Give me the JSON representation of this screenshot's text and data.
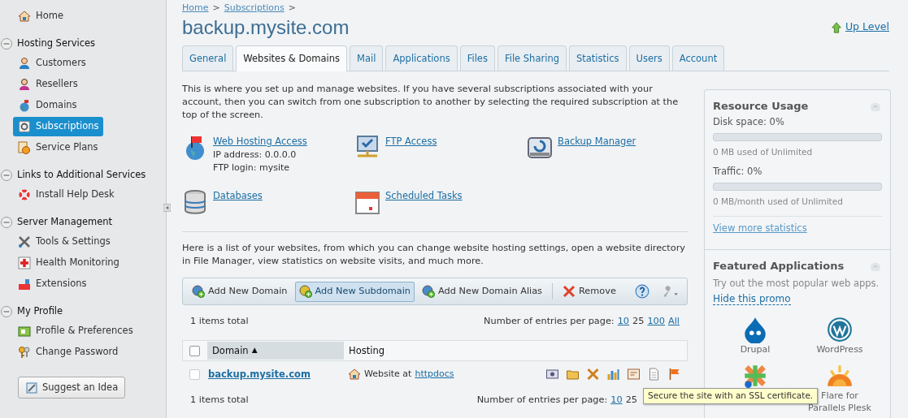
{
  "sidebar": {
    "home": {
      "label": "Home"
    },
    "sections": [
      {
        "title": "Hosting Services",
        "expanded": true,
        "items": [
          {
            "label": "Customers",
            "selected": false
          },
          {
            "label": "Resellers",
            "selected": false
          },
          {
            "label": "Domains",
            "selected": false
          },
          {
            "label": "Subscriptions",
            "selected": true
          },
          {
            "label": "Service Plans",
            "selected": false
          }
        ]
      },
      {
        "title": "Links to Additional Services",
        "expanded": true,
        "items": [
          {
            "label": "Install Help Desk",
            "selected": false
          }
        ]
      },
      {
        "title": "Server Management",
        "expanded": true,
        "items": [
          {
            "label": "Tools & Settings",
            "selected": false
          },
          {
            "label": "Health Monitoring",
            "selected": false
          },
          {
            "label": "Extensions",
            "selected": false
          }
        ]
      },
      {
        "title": "My Profile",
        "expanded": true,
        "items": [
          {
            "label": "Profile & Preferences",
            "selected": false
          },
          {
            "label": "Change Password",
            "selected": false
          }
        ]
      }
    ],
    "suggest_button": "Suggest an Idea"
  },
  "breadcrumbs": [
    "Home",
    "Subscriptions"
  ],
  "breadcrumb_separator": ">",
  "title": "backup.mysite.com",
  "up_level": "Up Level",
  "tabs": [
    {
      "label": "General",
      "selected": false
    },
    {
      "label": "Websites & Domains",
      "selected": true
    },
    {
      "label": "Mail",
      "selected": false
    },
    {
      "label": "Applications",
      "selected": false
    },
    {
      "label": "Files",
      "selected": false
    },
    {
      "label": "File Sharing",
      "selected": false
    },
    {
      "label": "Statistics",
      "selected": false
    },
    {
      "label": "Users",
      "selected": false
    },
    {
      "label": "Account",
      "selected": false
    }
  ],
  "intro": "This is where you set up and manage websites. If you have several subscriptions associated with your account, then you can switch from one subscription to another by selecting the required subscription at the top of the screen.",
  "tools": [
    {
      "label": "Web Hosting Access",
      "details": [
        "IP address: 0.0.0.0",
        "FTP login: mysite"
      ]
    },
    {
      "label": "FTP Access"
    },
    {
      "label": "Backup Manager"
    },
    {
      "label": "Databases"
    },
    {
      "label": "Scheduled Tasks"
    }
  ],
  "list_intro": "Here is a list of your websites, from which you can change website hosting settings, open a website directory in File Manager, view statistics on website visits, and much more.",
  "toolbar": [
    {
      "label": "Add New Domain",
      "kind": "add",
      "selected": false
    },
    {
      "label": "Add New Subdomain",
      "kind": "add",
      "selected": true
    },
    {
      "label": "Add New Domain Alias",
      "kind": "add",
      "selected": false
    },
    {
      "label": "Remove",
      "kind": "remove",
      "selected": false
    }
  ],
  "pager_top": {
    "total": "1 items total",
    "label": "Number of entries per page:",
    "options": [
      {
        "label": "10",
        "selected": false
      },
      {
        "label": "25",
        "selected": true
      },
      {
        "label": "100",
        "selected": false
      },
      {
        "label": "All",
        "selected": false
      }
    ]
  },
  "table": {
    "select_all_checked": false,
    "columns": [
      {
        "label": "Domain",
        "sorted": true,
        "sort_arrow": "▲"
      },
      {
        "label": "Hosting",
        "sorted": false
      }
    ],
    "rows": [
      {
        "checked": false,
        "domain": "backup.mysite.com",
        "hosting_prefix": "Website at",
        "hosting_link": "httpdocs"
      }
    ]
  },
  "pager_bottom": {
    "total": "1 items total",
    "label": "Number of entries per page:",
    "options": [
      {
        "label": "10",
        "selected": false
      },
      {
        "label": "25",
        "selected": true
      }
    ]
  },
  "tooltip": "Secure the site with an SSL certificate.",
  "resource_usage": {
    "title": "Resource Usage",
    "meters": [
      {
        "label": "Disk space: 0%",
        "level": 0,
        "note": "0 MB used of Unlimited"
      },
      {
        "label": "Traffic: 0%",
        "level": 0,
        "note": "0 MB/month used of Unlimited"
      }
    ],
    "link": "View more statistics"
  },
  "featured": {
    "title": "Featured Applications",
    "text": "Try out the most popular web apps.",
    "hide_link": "Hide this promo",
    "apps": [
      {
        "label": "Drupal"
      },
      {
        "label": "WordPress"
      },
      {
        "label": "Flare for Parallels Plesk"
      }
    ]
  }
}
